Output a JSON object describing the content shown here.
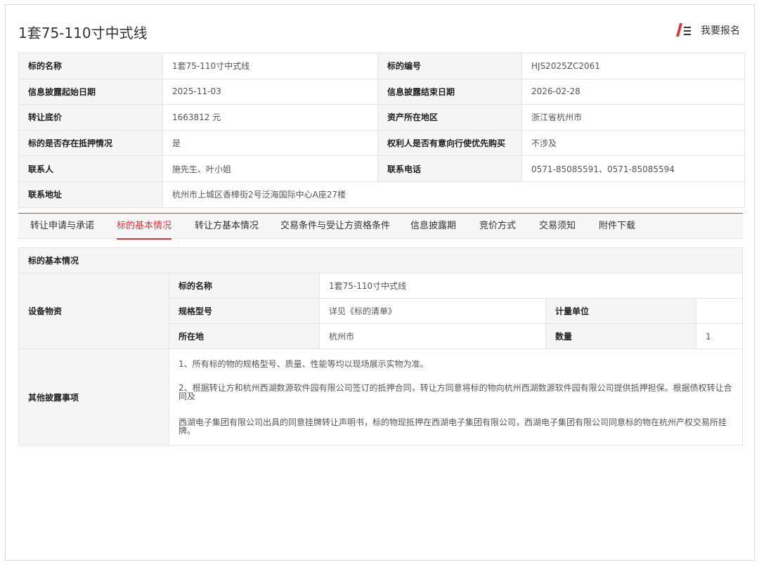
{
  "header": {
    "title": "1套75-110寸中式线",
    "signup_label": "我要报名",
    "icon": "signup-pen-icon",
    "accent": "#d9383a"
  },
  "info": {
    "rows": [
      [
        "标的名称",
        "1套75-110寸中式线",
        "标的编号",
        "HJS2025ZC2061"
      ],
      [
        "信息披露起始日期",
        "2025-11-03",
        "信息披露结束日期",
        "2026-02-28"
      ],
      [
        "转让底价",
        "1663812 元",
        "资产所在地区",
        "浙江省杭州市"
      ],
      [
        "标的是否存在抵押情况",
        "是",
        "权利人是否有意向行使优先购买",
        "不涉及"
      ],
      [
        "联系人",
        "施先生、叶小姐",
        "联系电话",
        "0571-85085591、0571-85085594"
      ]
    ],
    "address_label": "联系地址",
    "address_value": "杭州市上城区香樟街2号泛海国际中心A座27楼"
  },
  "tabs": [
    {
      "label": "转让申请与承诺"
    },
    {
      "label": "标的基本情况",
      "active": true
    },
    {
      "label": "转让方基本情况"
    },
    {
      "label": "交易条件与受让方资格条件"
    },
    {
      "label": "信息披露期"
    },
    {
      "label": "竞价方式"
    },
    {
      "label": "交易须知"
    },
    {
      "label": "附件下载"
    }
  ],
  "basic": {
    "section_title": "标的基本情况",
    "equipment_label": "设备物资",
    "name_label": "标的名称",
    "name_value": "1套75-110寸中式线",
    "spec_label": "规格型号",
    "spec_value": "详见《标的清单》",
    "unit_label": "计量单位",
    "unit_value": "",
    "location_label": "所在地",
    "location_value": "杭州市",
    "qty_label": "数量",
    "qty_value": "1",
    "other_label": "其他披露事项",
    "other_p1": "1、所有标的物的规格型号、质量、性能等均以现场展示实物为准。",
    "other_p2": "2、根据转让方和杭州西湖数源软件园有限公司签订的抵押合同，转让方同意将标的物向杭州西湖数源软件园有限公司提供抵押担保。根据债权转让合同及",
    "other_p3": "西湖电子集团有限公司出具的同意挂牌转让声明书，标的物现抵押在西湖电子集团有限公司，西湖电子集团有限公司同意标的物在杭州产权交易所挂牌。"
  }
}
